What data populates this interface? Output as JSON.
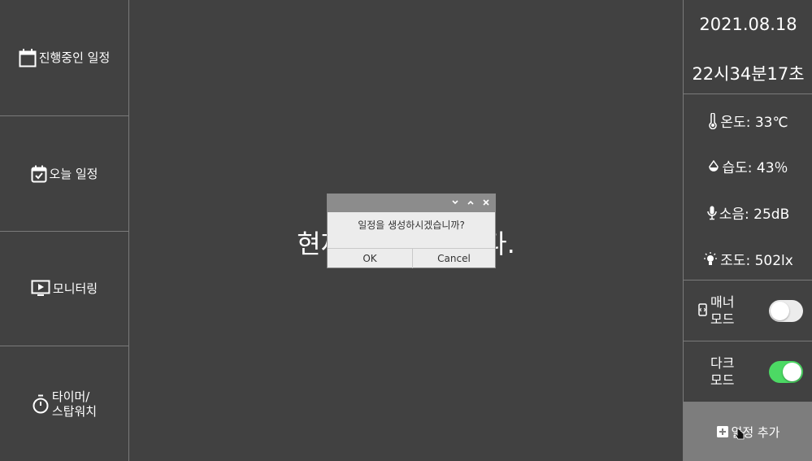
{
  "nav": {
    "items": [
      {
        "label": "진행중인 일정",
        "icon": "calendar-icon"
      },
      {
        "label": "오늘 일정",
        "icon": "calendar-check-icon"
      },
      {
        "label": "모니터링",
        "icon": "monitor-play-icon"
      },
      {
        "label": "타이머/\n스탑워치",
        "icon": "stopwatch-icon"
      }
    ]
  },
  "main": {
    "status_left": "현재",
    "status_right": "다."
  },
  "clock": {
    "date": "2021.08.18",
    "time": "22시34분17초"
  },
  "sensors": {
    "temperature": "온도: 33℃",
    "humidity": "습도: 43％",
    "noise": "소음: 25dB",
    "illuminance": "조도: 502lx"
  },
  "toggles": {
    "manner_label": "매너\n모드",
    "manner_on": false,
    "dark_label": "다크\n모드",
    "dark_on": true
  },
  "add_button": {
    "label": "일정 추가"
  },
  "dialog": {
    "message": "일정을 생성하시겠습니까?",
    "ok_label": "OK",
    "cancel_label": "Cancel"
  },
  "colors": {
    "background": "#414141",
    "divider": "#7a7a7a",
    "switch_on": "#4cd964",
    "switch_off": "#ececec",
    "add_button_bg": "#7d7d7d"
  }
}
